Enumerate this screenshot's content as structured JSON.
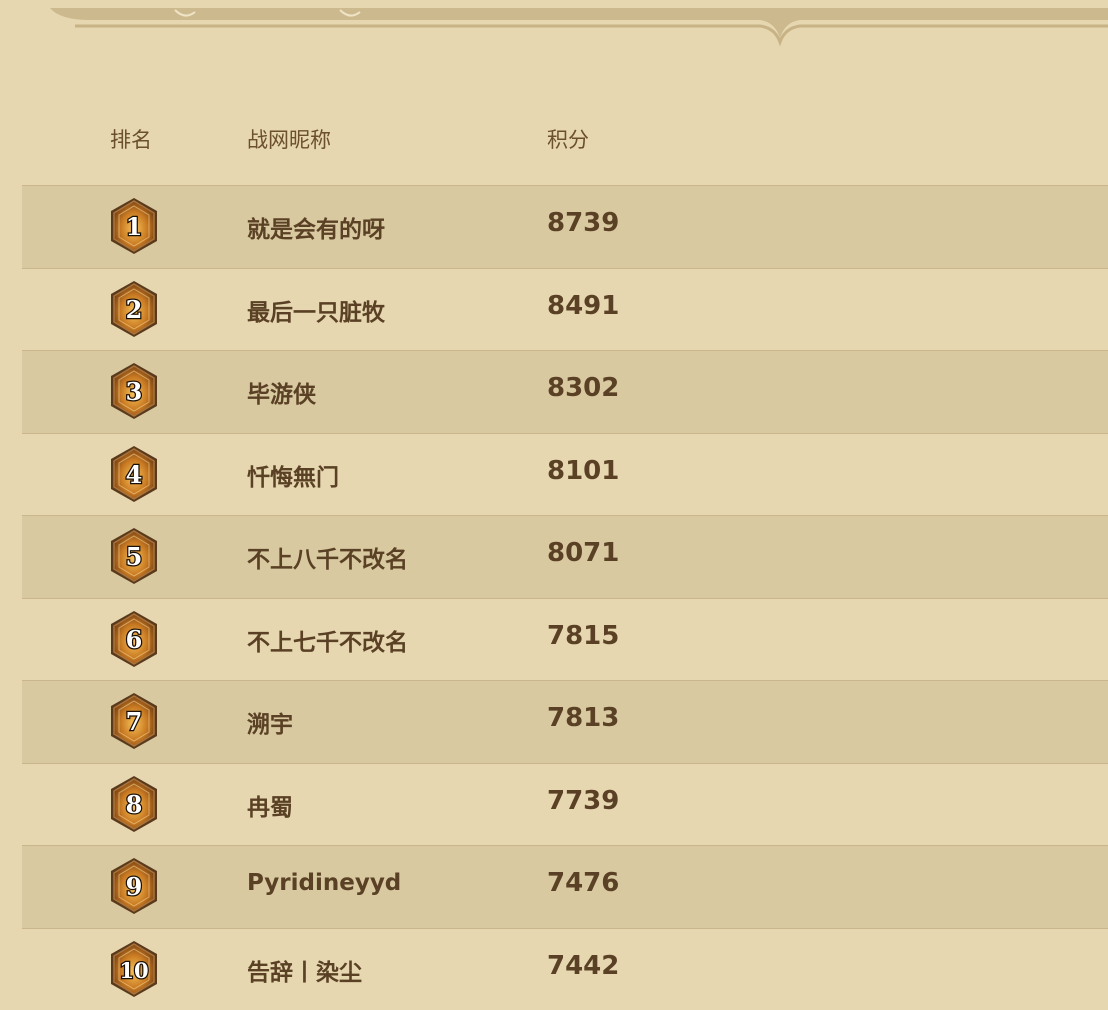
{
  "header": {
    "rank": "排名",
    "name": "战网昵称",
    "score": "积分"
  },
  "rows": [
    {
      "rank": "1",
      "name": "就是会有的呀",
      "score": "8739"
    },
    {
      "rank": "2",
      "name": "最后一只脏牧",
      "score": "8491"
    },
    {
      "rank": "3",
      "name": "毕游侠",
      "score": "8302"
    },
    {
      "rank": "4",
      "name": "忏悔無门",
      "score": "8101"
    },
    {
      "rank": "5",
      "name": "不上八千不改名",
      "score": "8071"
    },
    {
      "rank": "6",
      "name": "不上七千不改名",
      "score": "7815"
    },
    {
      "rank": "7",
      "name": "溯宇",
      "score": "7813"
    },
    {
      "rank": "8",
      "name": "冉蜀",
      "score": "7739"
    },
    {
      "rank": "9",
      "name": "Pyridineyyd",
      "score": "7476"
    },
    {
      "rank": "10",
      "name": "告辞丨染尘",
      "score": "7442"
    }
  ],
  "icons": {
    "rank_badge": "hexagon-rank-badge-icon"
  },
  "colors": {
    "background": "#e6d7b0",
    "row_shaded": "#d8c9a0",
    "text": "#5a4024"
  }
}
